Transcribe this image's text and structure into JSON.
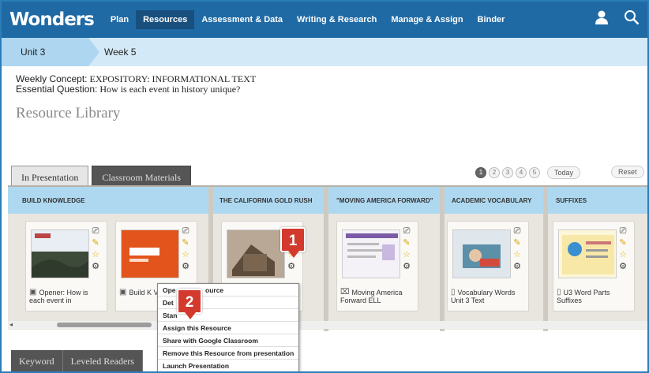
{
  "brand": {
    "logo": "Wonders",
    "nav_bg": "#1f6aa5",
    "accent": "#aed8f0",
    "badge_color": "#d23a2d"
  },
  "nav": {
    "items": [
      "Plan",
      "Resources",
      "Assessment & Data",
      "Writing & Research",
      "Manage & Assign",
      "Binder"
    ],
    "active": "Resources",
    "user_icon": "user-icon",
    "search_icon": "search-icon"
  },
  "breadcrumb": {
    "unit": "Unit 3",
    "week": "Week 5"
  },
  "concept": {
    "weekly_label": "Weekly Concept:",
    "weekly_value": "EXPOSITORY: INFORMATIONAL TEXT",
    "question_label": "Essential Question:",
    "question_value": "How is each event in history unique?"
  },
  "library": {
    "title": "Resource Library"
  },
  "tabs": {
    "in_presentation": "In Presentation",
    "classroom_materials": "Classroom Materials"
  },
  "pager": {
    "pages": [
      "1",
      "2",
      "3",
      "4",
      "5"
    ],
    "current": "1",
    "today": "Today",
    "reset": "Reset"
  },
  "sections": [
    "BUILD KNOWLEDGE",
    "THE CALIFORNIA GOLD RUSH",
    "\"MOVING AMERICA FORWARD\"",
    "ACADEMIC VOCABULARY",
    "SUFFIXES"
  ],
  "cards": [
    {
      "title": "Opener: How is each event in",
      "icon": "video-icon"
    },
    {
      "title": "Build K Video",
      "icon": "video-icon"
    },
    {
      "title": "",
      "icon": ""
    },
    {
      "title": "Moving America Forward ELL",
      "icon": "book-icon"
    },
    {
      "title": "Vocabulary Words Unit 3 Text",
      "icon": "document-icon"
    },
    {
      "title": "U3 Word Parts Suffixes",
      "icon": "document-icon"
    }
  ],
  "menu": {
    "items": [
      "Open Resource",
      "Details",
      "Standards",
      "Assign this Resource",
      "Share with Google Classroom",
      "Remove this Resource from presentation",
      "Launch Presentation"
    ],
    "row0_left": "Ope",
    "row0_right": "ource",
    "row1": "Det",
    "row2": "Stan"
  },
  "callouts": {
    "first": "1",
    "second": "2"
  },
  "bottom_tabs": {
    "keyword": "Keyword",
    "leveled_readers": "Leveled Readers"
  }
}
